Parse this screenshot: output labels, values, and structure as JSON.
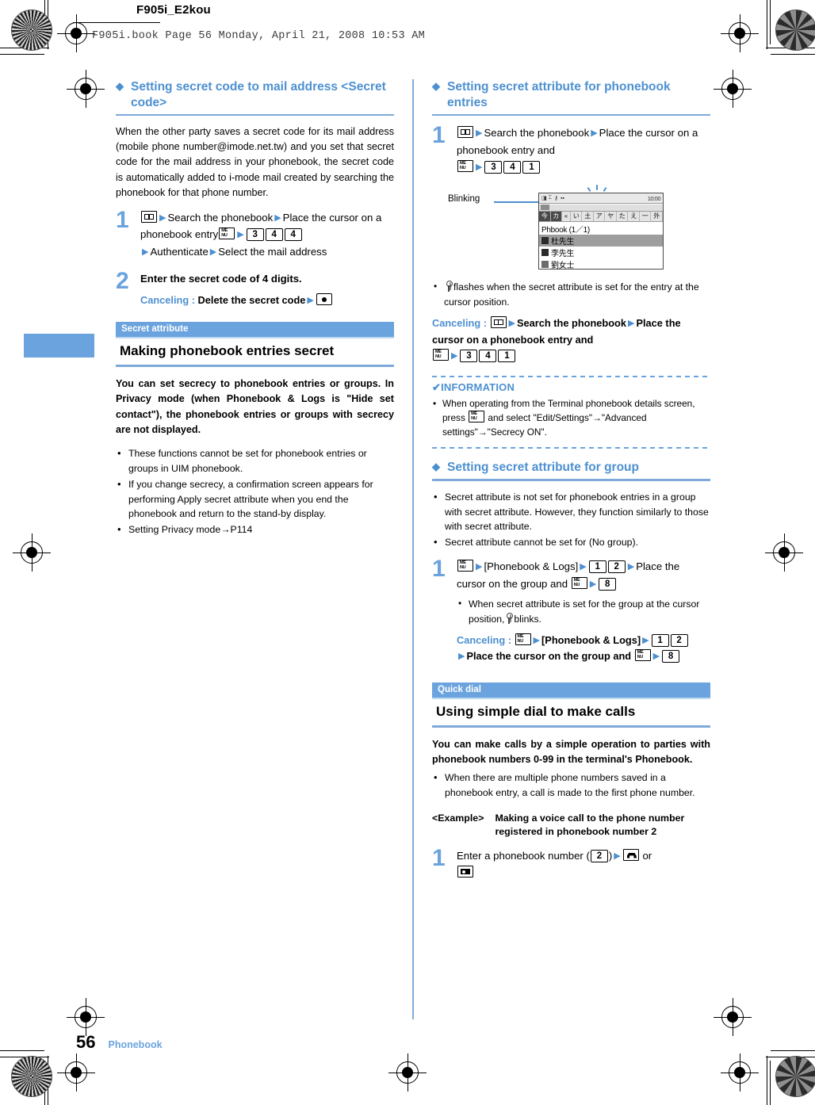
{
  "print": {
    "running_head": "F905i_E2kou",
    "book_line": "F905i.book  Page 56  Monday, April 21, 2008  10:53 AM"
  },
  "footer": {
    "page_number": "56",
    "chapter": "Phonebook"
  },
  "left_column": {
    "section_a": {
      "heading": "Setting secret code to mail address <Secret code>",
      "intro": "When the other party saves a secret code for its mail address (mobile phone number@imode.net.tw) and you set that secret code for the mail address in your phonebook, the secret code is automatically added to i-mode mail created by searching the phonebook for that phone number.",
      "step1": {
        "number": "1",
        "part1": "Search the phonebook",
        "part2": "Place the cursor on a phonebook entry",
        "keys": [
          "3",
          "4",
          "4"
        ],
        "part3": "Authenticate",
        "part4": "Select the mail address",
        "icon_book": "phonebook-key-icon",
        "icon_menu": "menu-key-icon"
      },
      "step2": {
        "number": "2",
        "text": "Enter the secret code of 4 digits.",
        "canceling_label": "Canceling :",
        "canceling_text": "Delete the secret code",
        "canceling_icon": "select-key-icon"
      }
    },
    "section_b": {
      "kicker": "Secret attribute",
      "title": "Making phonebook entries secret",
      "lead": "You can set secrecy to phonebook entries or groups. In Privacy mode (when Phonebook & Logs is \"Hide set contact\"), the phonebook entries or groups with secrecy are not displayed.",
      "bullets": [
        "These functions cannot be set for phonebook entries or groups in UIM phonebook.",
        "If you change secrecy, a confirmation screen appears for performing Apply secret attribute when you end the phonebook and return to the stand-by display.",
        "Setting Privacy mode→P114"
      ]
    }
  },
  "right_column": {
    "section_c": {
      "heading": "Setting secret attribute for phonebook entries",
      "step1": {
        "number": "1",
        "part1": "Search the phonebook",
        "part2": "Place the cursor on a phonebook entry and",
        "keys": [
          "3",
          "4",
          "1"
        ]
      },
      "figure": {
        "label": "Blinking",
        "screen": {
          "clock": "10:00",
          "tabs": [
            "今",
            "カ",
            "«",
            "い",
            "土",
            "ア",
            "ヤ",
            "た",
            "え",
            "一",
            "外"
          ],
          "title": "Phbook (1／1)",
          "rows": [
            {
              "name": "杜先生",
              "selected": true
            },
            {
              "name": "李先生",
              "selected": false
            },
            {
              "name": "劉女士",
              "selected": false
            }
          ]
        }
      },
      "note_bullet": "flashes when the secret attribute is set for the entry at the cursor position.",
      "canceling": {
        "label": "Canceling :",
        "part1": "Search the phonebook",
        "part2": "Place the cursor on a phonebook entry and",
        "keys": [
          "3",
          "4",
          "1"
        ]
      }
    },
    "information": {
      "title": "INFORMATION",
      "items": [
        "When operating from the Terminal phonebook details screen, press ",
        " and select \"Edit/Settings\"→\"Advanced settings\"→\"Secrecy ON\"."
      ]
    },
    "section_d": {
      "heading": "Setting secret attribute for group",
      "bullets": [
        "Secret attribute is not set for phonebook entries in a group with secret attribute. However, they function similarly to those with secret attribute.",
        "Secret attribute cannot be set for  (No group)."
      ],
      "step1": {
        "number": "1",
        "menu_label": "[Phonebook & Logs]",
        "keys": [
          "1",
          "2"
        ],
        "part2": "Place the cursor on the group and",
        "key_last": "8"
      },
      "note_bullet_pre": "When secret attribute is set for the group at the cursor position,",
      "note_bullet_post": "blinks.",
      "canceling": {
        "label": "Canceling :",
        "menu_label": "[Phonebook & Logs]",
        "keys": [
          "1",
          "2"
        ],
        "part2": "Place the cursor on the group and",
        "key_last": "8"
      }
    },
    "section_e": {
      "kicker": "Quick dial",
      "title": "Using simple dial to make calls",
      "lead": "You can make calls by a simple operation to parties with phonebook numbers 0-99 in the terminal's Phonebook.",
      "bullets": [
        "When there are multiple phone numbers saved in a phonebook entry, a call is made to the first phone number."
      ],
      "example_tag": "<Example>",
      "example_text": "Making a voice call to the phone number registered in phonebook number 2",
      "step1": {
        "number": "1",
        "text_pre": "Enter a phonebook number (",
        "key": "2",
        "text_post": ")",
        "or": "or"
      }
    }
  },
  "colors": {
    "accent_blue": "#4d90d0",
    "banner_blue": "#6ba3de",
    "rule_blue": "#7fa9d8",
    "light_blue": "#bcd8ef"
  }
}
